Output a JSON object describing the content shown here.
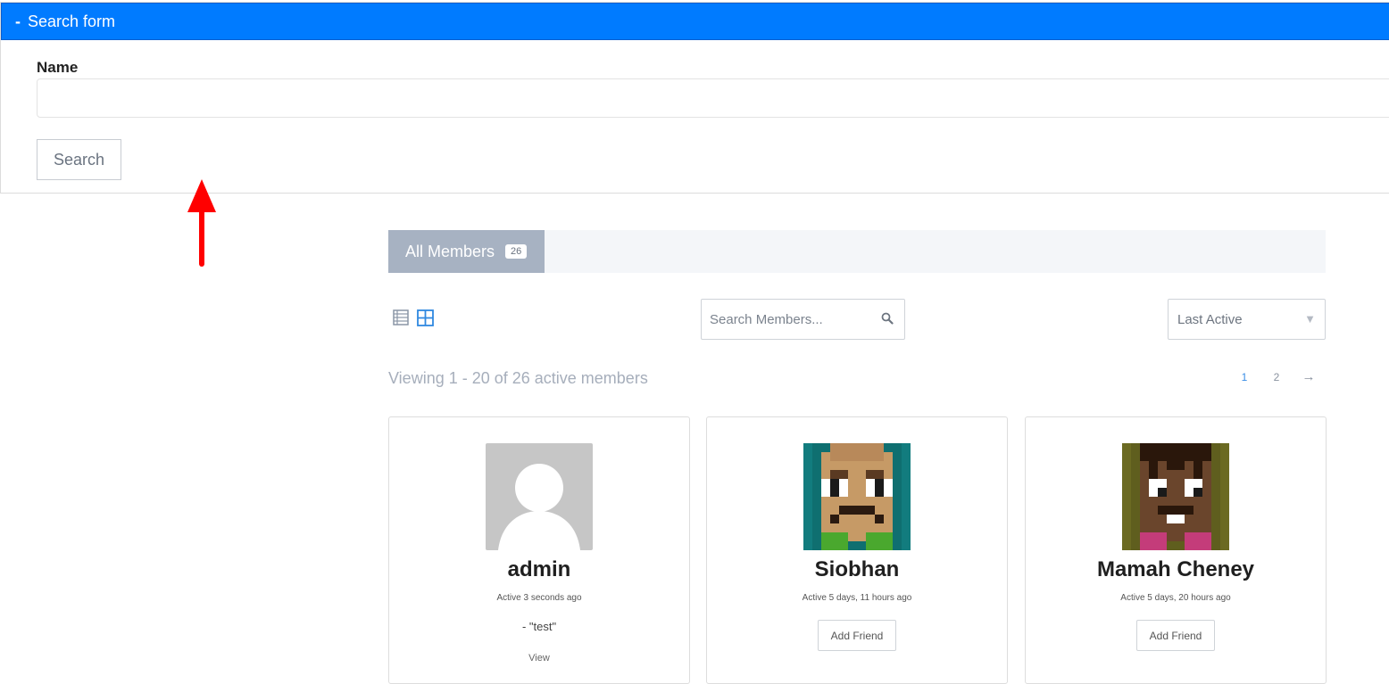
{
  "search_form": {
    "toggle": "-",
    "title": "Search form",
    "name_label": "Name",
    "name_value": "",
    "search_button": "Search"
  },
  "member_tabs": {
    "all_members_label": "All Members",
    "all_members_count": "26"
  },
  "directory": {
    "search_placeholder": "Search Members...",
    "order_by_selected": "Last Active",
    "viewing_text": "Viewing 1 - 20 of 26 active members",
    "pages": [
      "1",
      "2"
    ],
    "next_label": "→"
  },
  "members": [
    {
      "name": "admin",
      "last_active": "Active 3 seconds ago",
      "latest_update": "- \"test\"",
      "action": "View"
    },
    {
      "name": "Siobhan",
      "last_active": "Active 5 days, 11 hours ago",
      "action": "Add Friend"
    },
    {
      "name": "Mamah Cheney",
      "last_active": "Active 5 days, 20 hours ago",
      "action": "Add Friend"
    }
  ],
  "colors": {
    "header_blue": "#007bff",
    "tab_active": "#a7b2c2",
    "annotation_arrow": "#ff0000"
  },
  "icons": [
    "list-view-icon",
    "grid-view-icon",
    "search-icon",
    "caret-down-icon",
    "annotation-arrow-icon"
  ]
}
